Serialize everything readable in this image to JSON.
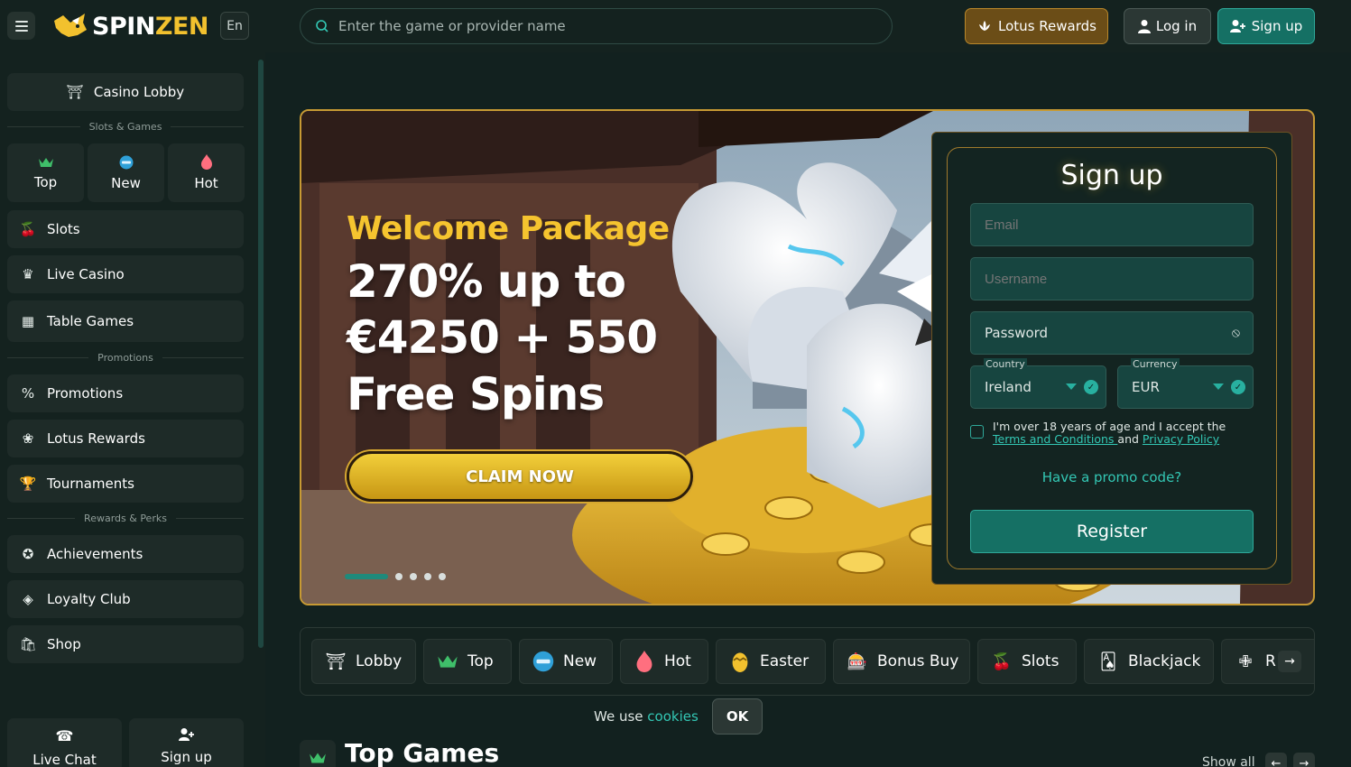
{
  "header": {
    "logo_prefix": "SPIN",
    "logo_suffix": "ZEN",
    "language": "En",
    "search_placeholder": "Enter the game or provider name",
    "lotus_rewards": "Lotus Rewards",
    "login": "Log in",
    "signup": "Sign up"
  },
  "sidebar": {
    "casino_lobby": "Casino Lobby",
    "section_slots": "Slots & Games",
    "tiles": [
      {
        "label": "Top",
        "icon": "crown-icon"
      },
      {
        "label": "New",
        "icon": "new-badge-icon"
      },
      {
        "label": "Hot",
        "icon": "fire-icon"
      }
    ],
    "games": [
      {
        "label": "Slots",
        "icon": "cherries-icon"
      },
      {
        "label": "Live Casino",
        "icon": "dealer-icon"
      },
      {
        "label": "Table Games",
        "icon": "table-icon"
      }
    ],
    "section_promotions": "Promotions",
    "promos": [
      {
        "label": "Promotions",
        "icon": "percent-icon"
      },
      {
        "label": "Lotus Rewards",
        "icon": "lotus-icon"
      },
      {
        "label": "Tournaments",
        "icon": "trophy-icon"
      }
    ],
    "section_rewards": "Rewards & Perks",
    "rewards": [
      {
        "label": "Achievements",
        "icon": "medal-icon"
      },
      {
        "label": "Loyalty Club",
        "icon": "diamond-icon"
      },
      {
        "label": "Shop",
        "icon": "shop-bag-icon"
      }
    ],
    "bottom": [
      {
        "label": "Live Chat",
        "icon": "chat-icon"
      },
      {
        "label": "Sign up",
        "icon": "add-user-icon"
      }
    ]
  },
  "hero": {
    "title": "Welcome Package",
    "line1": "270% up to",
    "line2": "€4250 + 550",
    "line3": "Free Spins",
    "cta": "CLAIM NOW",
    "slides_total": 5,
    "slide_active": 1
  },
  "signup_form": {
    "title": "Sign up",
    "email_placeholder": "Email",
    "username_placeholder": "Username",
    "password_placeholder": "Password",
    "country_label": "Country",
    "country_value": "Ireland",
    "currency_label": "Currency",
    "currency_value": "EUR",
    "consent_prefix": "I'm over 18 years of age and I accept the ",
    "terms_link": "Terms and Conditions ",
    "consent_and": "and ",
    "privacy_link": "Privacy Policy",
    "promo_code": "Have a promo code?",
    "register": "Register"
  },
  "categories": [
    {
      "label": "Lobby",
      "icon": "lobby-icon"
    },
    {
      "label": "Top",
      "icon": "crown-icon"
    },
    {
      "label": "New",
      "icon": "new-badge-icon"
    },
    {
      "label": "Hot",
      "icon": "fire-icon"
    },
    {
      "label": "Easter",
      "icon": "easter-egg-icon"
    },
    {
      "label": "Bonus Buy",
      "icon": "bonus-buy-icon"
    },
    {
      "label": "Slots",
      "icon": "cherries-icon"
    },
    {
      "label": "Blackjack",
      "icon": "cards-icon"
    },
    {
      "label": "R",
      "icon": "roulette-icon"
    }
  ],
  "cookie": {
    "text": "We use ",
    "link": "cookies",
    "ok": "OK"
  },
  "top_games": {
    "title": "Top Games",
    "show_all": "Show all"
  },
  "colors": {
    "accent_teal": "#157064",
    "accent_gold": "#f5c42f",
    "background": "#12211f"
  }
}
